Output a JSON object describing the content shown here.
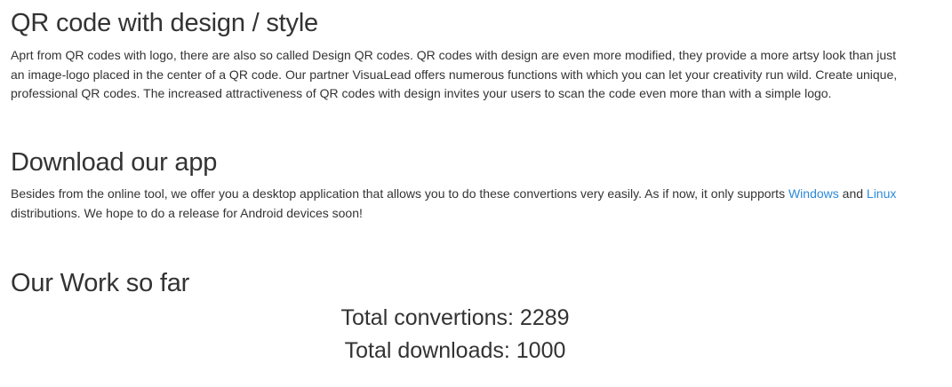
{
  "sections": {
    "design": {
      "title": "QR code with design / style",
      "body": "Aprt from QR codes with logo, there are also so called Design QR codes. QR codes with design are even more modified, they provide a more artsy look than just an image-logo placed in the center of a QR code. Our partner VisuaLead offers numerous functions with which you can let your creativity run wild. Create unique, professional QR codes. The increased attractiveness of QR codes with design invites your users to scan the code even more than with a simple logo."
    },
    "app": {
      "title": "Download our app",
      "body_before": "Besides from the online tool, we offer you a desktop application that allows you to do these convertions very easily. As if now, it only supports ",
      "windows_link": "Windows",
      "body_middle": " and ",
      "linux_link": "Linux",
      "body_after": " distributions. We hope to do a release for Android devices soon!"
    },
    "work": {
      "title": "Our Work so far",
      "total_convertions": "Total convertions: 2289",
      "total_downloads": "Total downloads: 1000"
    }
  },
  "colors": {
    "text": "#333333",
    "link": "#2a8ad8",
    "background": "#ffffff"
  }
}
